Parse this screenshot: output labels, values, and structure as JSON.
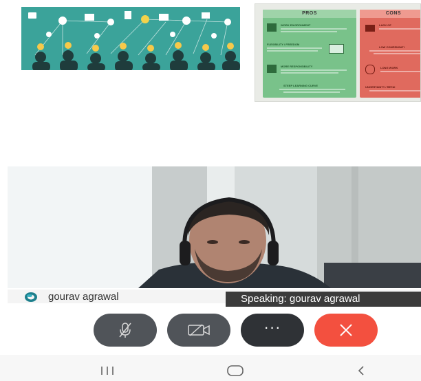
{
  "shared_slides": [
    {
      "name": "social-network-illustration"
    },
    {
      "name": "pros-cons-table",
      "pros": {
        "heading": "PROS",
        "rows": [
          "WORK ENVIRONMENT",
          "FLEXIBILITY / FREEDOM",
          "MORE RESPONSIBILITY",
          "STEEP LEARNING CURVE"
        ]
      },
      "cons": {
        "heading": "CONS",
        "rows": [
          "LACK OF",
          "LOW COMPENSATI",
          "LONG WORK",
          "UNCERTAINTY / RETAI"
        ]
      }
    }
  ],
  "participant": {
    "name": "gourav agrawal",
    "speaking_label": "Speaking: gourav agrawal"
  },
  "controls": {
    "mic": {
      "icon": "microphone-muted-icon",
      "state": "muted"
    },
    "camera": {
      "icon": "camera-off-icon",
      "state": "off"
    },
    "more": {
      "icon": "more-options-icon",
      "label": "···"
    },
    "end": {
      "icon": "end-call-icon"
    }
  },
  "system_nav": {
    "recents_icon": "recents-icon",
    "home_icon": "home-icon",
    "back_icon": "back-icon"
  },
  "colors": {
    "end_call": "#f3503f",
    "control_bg": "#505459",
    "more_bg": "#2f3236",
    "slide_teal": "#3ba39a",
    "pros_green": "#79c28a",
    "cons_red": "#e06a5e"
  }
}
